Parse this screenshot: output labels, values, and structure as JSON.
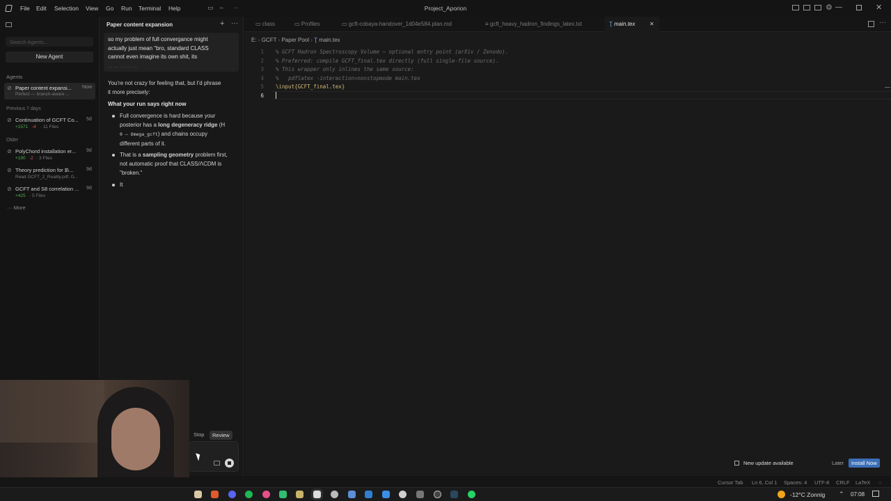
{
  "window": {
    "title": "Project_Aporion",
    "menu": [
      "File",
      "Edit",
      "Selection",
      "View",
      "Go",
      "Run",
      "Terminal",
      "Help"
    ]
  },
  "sidebar": {
    "search_placeholder": "Search Agents...",
    "new_agent": "New Agent",
    "agents_heading": "Agents",
    "current": {
      "title": "Paper content expansi...",
      "subtitle": "Perfect — branch-aware ...",
      "time": "Now"
    },
    "previous_heading": "Previous 7 days",
    "previous": [
      {
        "title": "Continuation of GCFT Co...",
        "plus": "+1571",
        "minus": "-4",
        "files": "· 11 Files",
        "time": "5d"
      }
    ],
    "older_heading": "Older",
    "older": [
      {
        "title": "PolyChord installation er...",
        "plus": "+190",
        "minus": "-2",
        "files": "· 3 Files",
        "time": "9d"
      },
      {
        "title": "Theory prediction for $\\...",
        "sub": "Read GCFT_2_Reality.pdf, G...",
        "time": "9d"
      },
      {
        "title": "GCFT and S8 correlation ...",
        "plus": "+425",
        "files": "· 5 Files",
        "time": "9d"
      }
    ],
    "more": "More"
  },
  "chat": {
    "title": "Paper content expansion",
    "user_message": [
      "so my problem of full convergance might",
      "actually just mean \"bro, standard CLASS",
      "cannot even imagine its own shit, its",
      "... ... ... ... ..."
    ],
    "reply_intro": [
      "You're not crazy for feeling that, but I'd phrase",
      "it more precisely:"
    ],
    "section_heading": "What your run says right now",
    "bullet1": {
      "l1": "Full convergence is hard because your",
      "l2a": "posterior has a ",
      "l2b": "long degeneracy ridge",
      "l2c": " (H",
      "l3a": "0 – Omega_gcft",
      "l3b": ") and chains occupy",
      "l4": "different parts of it."
    },
    "bullet2": {
      "l1a": "That is a ",
      "l1b": "sampling geometry",
      "l1c": " problem first,",
      "l2": "not automatic proof that CLASS/ΛCDM is",
      "l3": "\"broken.\""
    },
    "bullet3": "It",
    "stop": "Stop",
    "review": "Review"
  },
  "editor": {
    "tabs": [
      {
        "label": "class"
      },
      {
        "label": "Profiles"
      },
      {
        "label": "gcft-cobaya-handover_1d04e584.plan.md"
      },
      {
        "label": "gcft_heavy_hadron_findings_latex.txt"
      },
      {
        "label": "main.tex"
      }
    ],
    "breadcrumb": [
      "E:",
      "GCFT",
      "Paper Pool",
      "main.tex"
    ],
    "lines": [
      "% GCFT Hadron Spectroscopy Volume — optional entry point (arXiv / Zenodo).",
      "% Preferred: compile GCFT_final.tex directly (full single-file source).",
      "% This wrapper only inlines the same source:",
      "%   pdflatex -interaction=nonstopmode main.tex",
      "\\input{GCFT_final.tex}",
      ""
    ],
    "line_numbers": [
      "1",
      "2",
      "3",
      "4",
      "5",
      "6"
    ]
  },
  "notification": {
    "text": "New update available",
    "later": "Later",
    "install": "Install Now"
  },
  "statusbar": {
    "items": [
      "Cursor Tab",
      "Ln 6, Col 1",
      "Spaces: 4",
      "UTF-8",
      "CRLF",
      "LaTeX"
    ]
  },
  "taskbar": {
    "weather": "-12°C Zonnig",
    "time": "07:08"
  }
}
